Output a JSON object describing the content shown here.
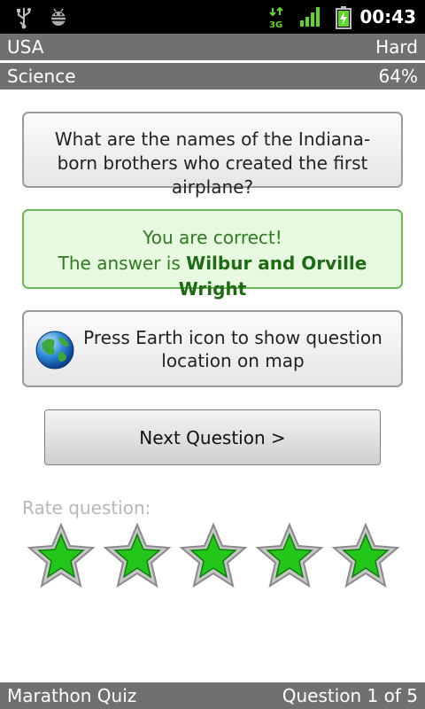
{
  "status_bar": {
    "time": "00:43",
    "network": "3G",
    "icons": [
      "usb-icon",
      "android-debug-icon",
      "network-3g-icon",
      "signal-icon",
      "battery-charging-icon"
    ]
  },
  "header": {
    "country": "USA",
    "difficulty": "Hard",
    "category": "Science",
    "score_percent": "64%"
  },
  "question": {
    "text": "What are the names of the Indiana-born brothers who created the first airplane?"
  },
  "answer": {
    "status": "You are correct!",
    "prefix": "The answer is ",
    "value": "Wilbur and Orville Wright"
  },
  "map_hint": {
    "text": "Press Earth icon to show question location on map",
    "icon": "earth-globe-icon"
  },
  "next_button": {
    "label": "Next Question >"
  },
  "rating": {
    "label": "Rate question:",
    "stars_filled": 5,
    "stars_total": 5
  },
  "footer": {
    "app_name": "Marathon Quiz",
    "progress": "Question 1 of 5"
  },
  "colors": {
    "header_bg": "#707070",
    "correct_green": "#2e7a20",
    "star_green": "#22c71a"
  }
}
